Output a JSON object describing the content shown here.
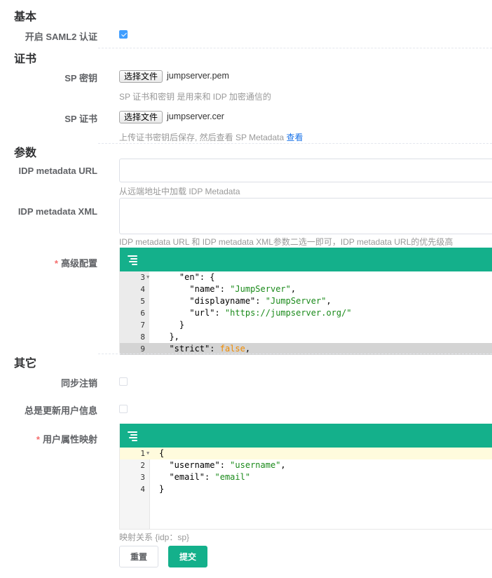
{
  "sections": {
    "basic": "基本",
    "cert": "证书",
    "params": "参数",
    "other": "其它"
  },
  "basic": {
    "enable_label": "开启 SAML2 认证",
    "enable_checked": true
  },
  "cert": {
    "sp_key_label": "SP 密钥",
    "sp_key_button": "选择文件",
    "sp_key_file": "jumpserver.pem",
    "sp_key_help": "SP 证书和密钥 是用来和 IDP 加密通信的",
    "sp_cert_label": "SP 证书",
    "sp_cert_button": "选择文件",
    "sp_cert_file": "jumpserver.cer",
    "sp_cert_help": "上传证书密钥后保存, 然后查看 SP Metadata",
    "sp_cert_help_link": "查看"
  },
  "params": {
    "idp_url_label": "IDP metadata URL",
    "idp_url_value": "",
    "idp_url_help": "从远端地址中加载 IDP Metadata",
    "idp_xml_label": "IDP metadata XML",
    "idp_xml_value": "",
    "idp_xml_help": "IDP metadata URL 和 IDP metadata XML参数二选一即可，IDP metadata URL的优先级高",
    "advanced_required": "*",
    "advanced_label": "高级配置",
    "advanced_lines": [
      {
        "num": "3",
        "fold": true,
        "text": "    \"en\": {"
      },
      {
        "num": "4",
        "fold": false,
        "text": "      \"name\": \"JumpServer\","
      },
      {
        "num": "5",
        "fold": false,
        "text": "      \"displayname\": \"JumpServer\","
      },
      {
        "num": "6",
        "fold": false,
        "text": "      \"url\": \"https://jumpserver.org/\""
      },
      {
        "num": "7",
        "fold": false,
        "text": "    }"
      },
      {
        "num": "8",
        "fold": false,
        "text": "  },"
      },
      {
        "num": "9",
        "fold": false,
        "text": "  \"strict\": false,"
      }
    ]
  },
  "other": {
    "sync_logout_label": "同步注销",
    "sync_logout_checked": false,
    "always_update_label": "总是更新用户信息",
    "always_update_checked": false,
    "mapping_required": "*",
    "mapping_label": "用户属性映射",
    "mapping_lines": [
      {
        "num": "1",
        "fold": true,
        "text": "{"
      },
      {
        "num": "2",
        "fold": false,
        "text": "  \"username\": \"username\","
      },
      {
        "num": "3",
        "fold": false,
        "text": "  \"email\": \"email\""
      },
      {
        "num": "4",
        "fold": false,
        "text": "}"
      }
    ],
    "mapping_help": "映射关系 {idp：sp}"
  },
  "actions": {
    "reset": "重置",
    "submit": "提交"
  },
  "colors": {
    "accent": "#14b08b",
    "checkbox": "#409eff",
    "link": "#1a73e8",
    "required": "#f56c6c"
  },
  "icons": [
    "checkbox-checked-icon",
    "menu-format-icon",
    "fold-arrow-icon"
  ]
}
